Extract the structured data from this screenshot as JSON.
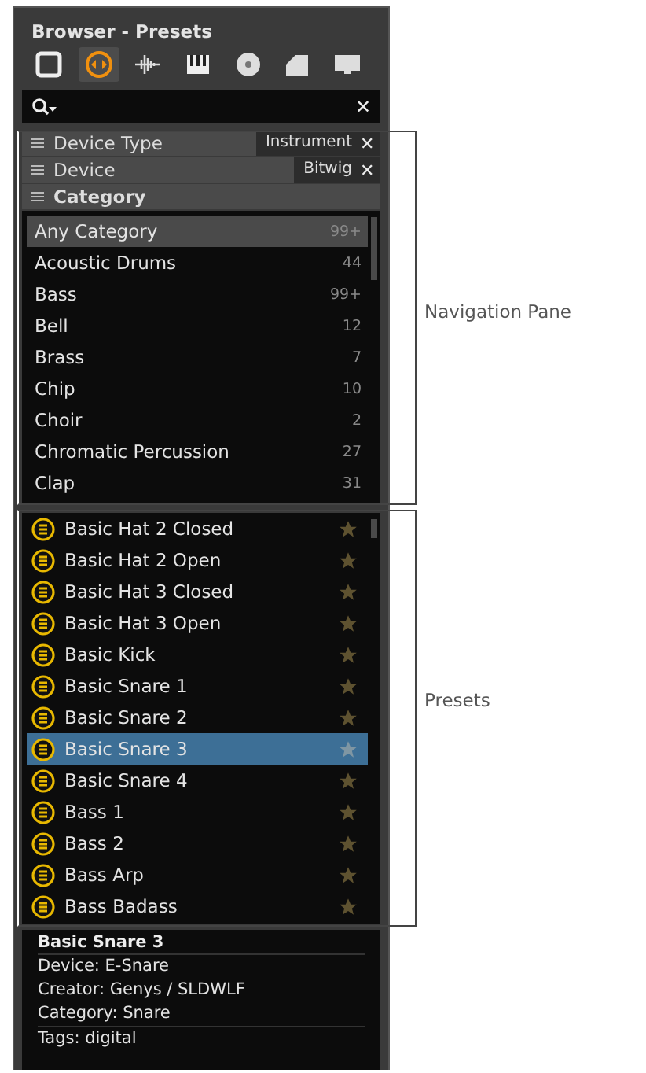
{
  "window": {
    "title": "Browser - Presets"
  },
  "tabs": [
    {
      "kind": "panel",
      "selected": false
    },
    {
      "kind": "device",
      "selected": true
    },
    {
      "kind": "sample",
      "selected": false
    },
    {
      "kind": "keys",
      "selected": false
    },
    {
      "kind": "disc",
      "selected": false
    },
    {
      "kind": "clip",
      "selected": false
    },
    {
      "kind": "screen",
      "selected": false
    }
  ],
  "search": {
    "clear": "✕"
  },
  "filters": [
    {
      "label": "Device Type",
      "value": "Instrument",
      "remove": "✕"
    },
    {
      "label": "Device",
      "value": "Bitwig",
      "remove": "✕"
    },
    {
      "label": "Category"
    }
  ],
  "categories": [
    {
      "name": "Any Category",
      "count": "99+",
      "selected": true
    },
    {
      "name": "Acoustic Drums",
      "count": "44",
      "selected": false
    },
    {
      "name": "Bass",
      "count": "99+",
      "selected": false
    },
    {
      "name": "Bell",
      "count": "12",
      "selected": false
    },
    {
      "name": "Brass",
      "count": "7",
      "selected": false
    },
    {
      "name": "Chip",
      "count": "10",
      "selected": false
    },
    {
      "name": "Choir",
      "count": "2",
      "selected": false
    },
    {
      "name": "Chromatic Percussion",
      "count": "27",
      "selected": false
    },
    {
      "name": "Clap",
      "count": "31",
      "selected": false
    }
  ],
  "presets": [
    {
      "name": "Basic Hat 2 Closed",
      "selected": false
    },
    {
      "name": "Basic Hat 2 Open",
      "selected": false
    },
    {
      "name": "Basic Hat 3 Closed",
      "selected": false
    },
    {
      "name": "Basic Hat 3 Open",
      "selected": false
    },
    {
      "name": "Basic Kick",
      "selected": false
    },
    {
      "name": "Basic Snare 1",
      "selected": false
    },
    {
      "name": "Basic Snare 2",
      "selected": false
    },
    {
      "name": "Basic Snare 3",
      "selected": true
    },
    {
      "name": "Basic Snare 4",
      "selected": false
    },
    {
      "name": "Bass 1",
      "selected": false
    },
    {
      "name": "Bass 2",
      "selected": false
    },
    {
      "name": "Bass Arp",
      "selected": false
    },
    {
      "name": "Bass Badass",
      "selected": false
    }
  ],
  "info": {
    "title": "Basic Snare 3",
    "lines": [
      "Device: E-Snare",
      "Creator: Genys / SLDWLF",
      "Category: Snare"
    ],
    "tags": "Tags: digital"
  },
  "callouts": [
    "Navigation Pane",
    "Presets"
  ]
}
